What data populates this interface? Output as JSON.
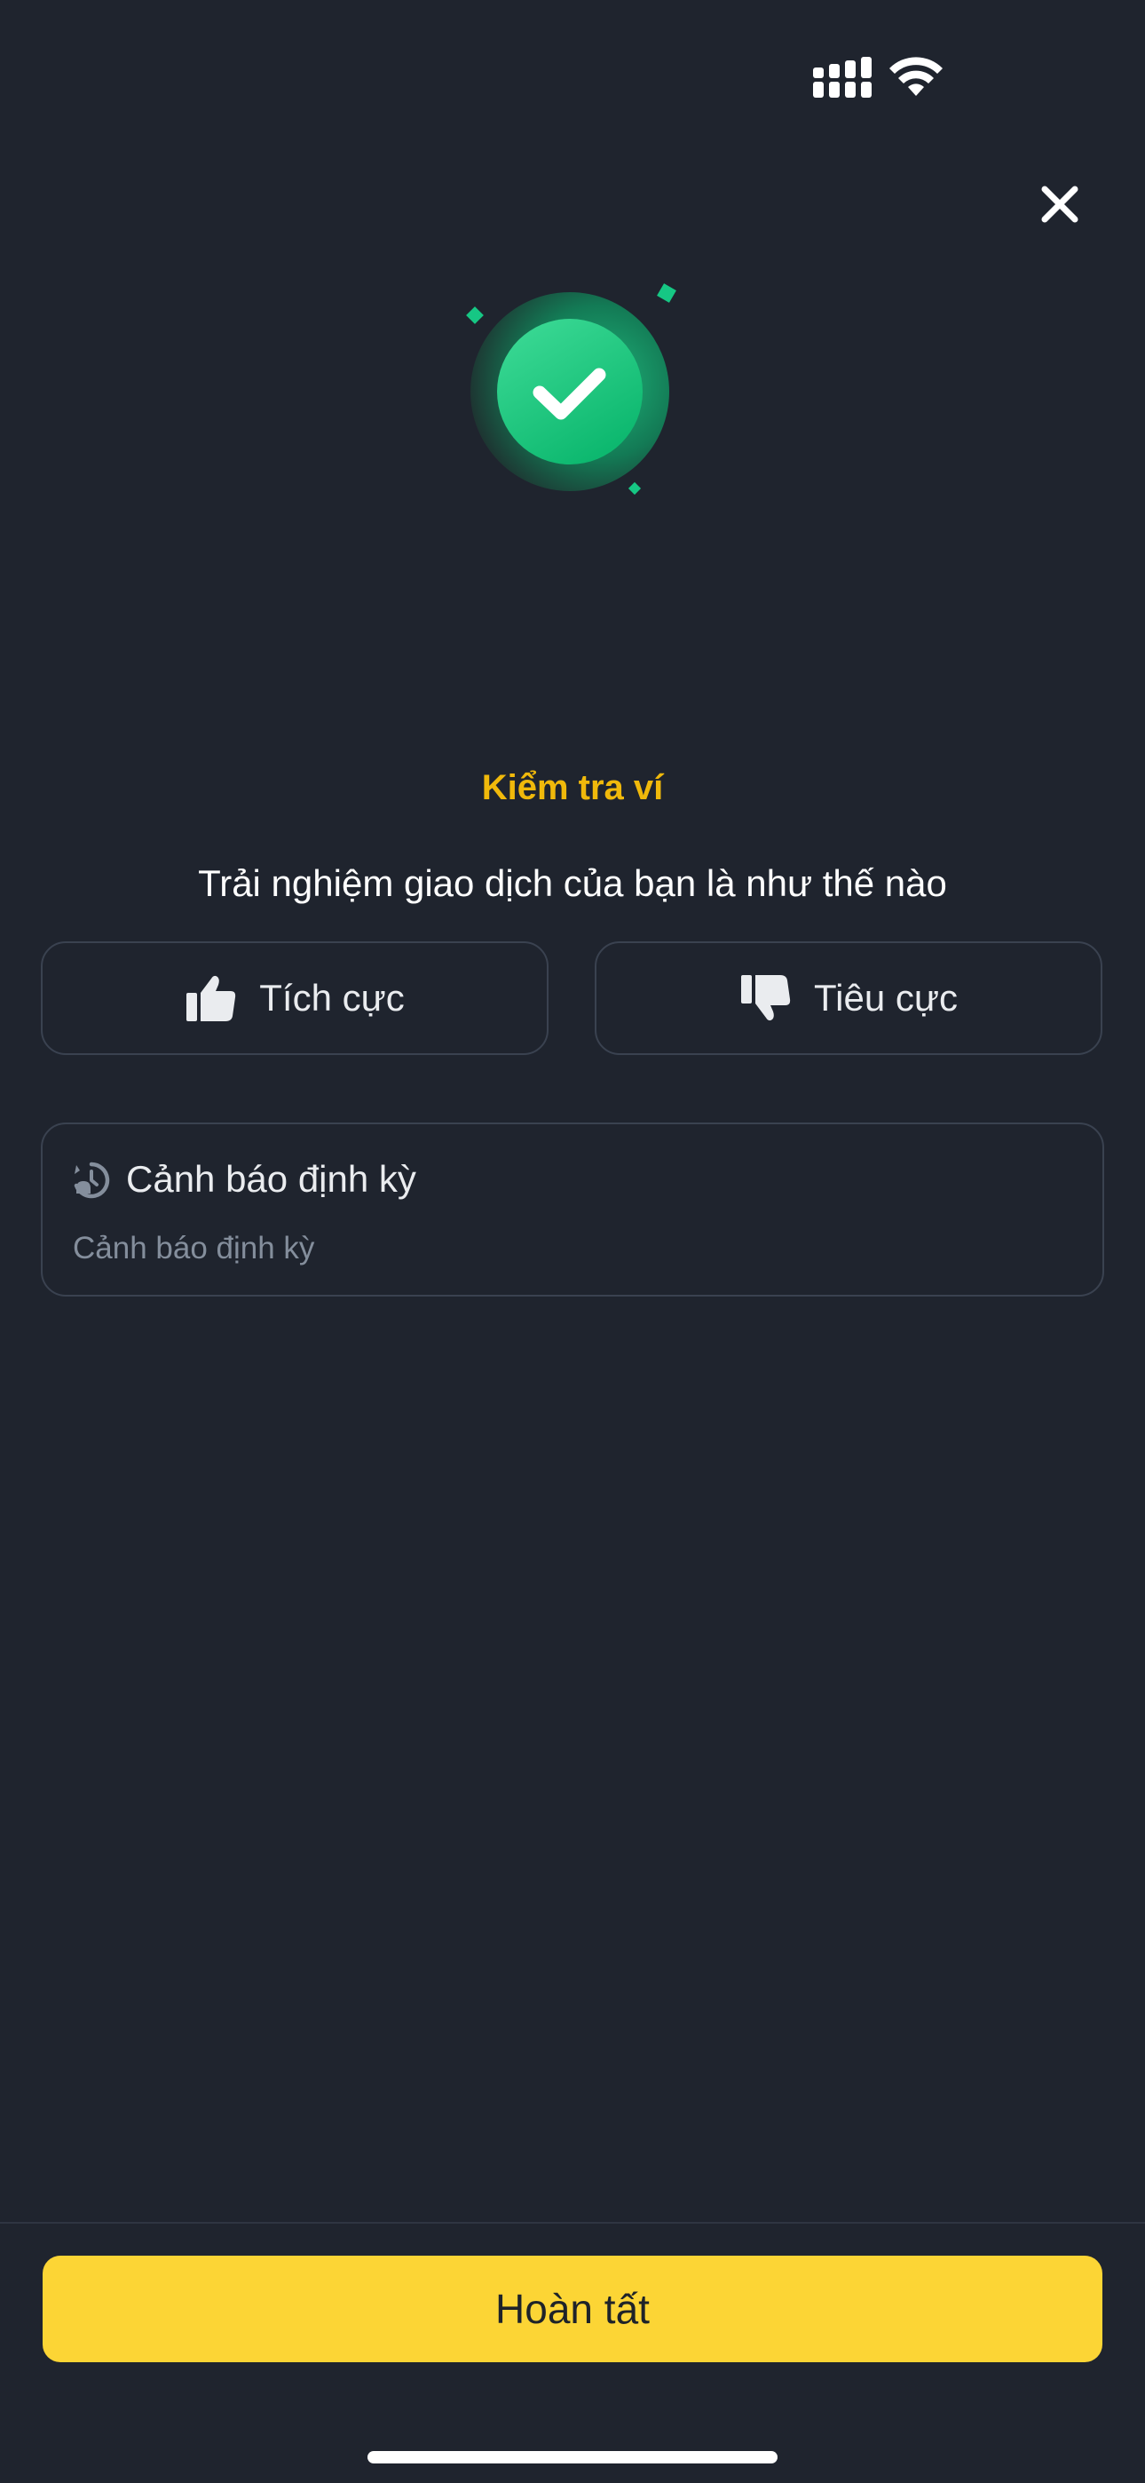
{
  "status_bar": {
    "signal_icon": "cellular-signal-icon",
    "wifi_icon": "wifi-icon"
  },
  "header": {
    "close_icon": "close-icon"
  },
  "result": {
    "icon": "success-check-icon",
    "accent_color": "#0ecb81",
    "subtitle": "Kiểm tra ví",
    "question": "Trải nghiệm giao dịch của bạn là như thế nào"
  },
  "feedback": {
    "positive_label": "Tích cực",
    "positive_icon": "thumbs-up-icon",
    "negative_label": "Tiêu cực",
    "negative_icon": "thumbs-down-icon"
  },
  "alert": {
    "icon": "recurring-alert-icon",
    "title": "Cảnh báo định kỳ",
    "description": "Cảnh báo định kỳ"
  },
  "footer": {
    "done_label": "Hoàn tất",
    "done_color": "#fcd535"
  },
  "colors": {
    "background": "#1f242e",
    "brand_yellow": "#f0b90b"
  }
}
